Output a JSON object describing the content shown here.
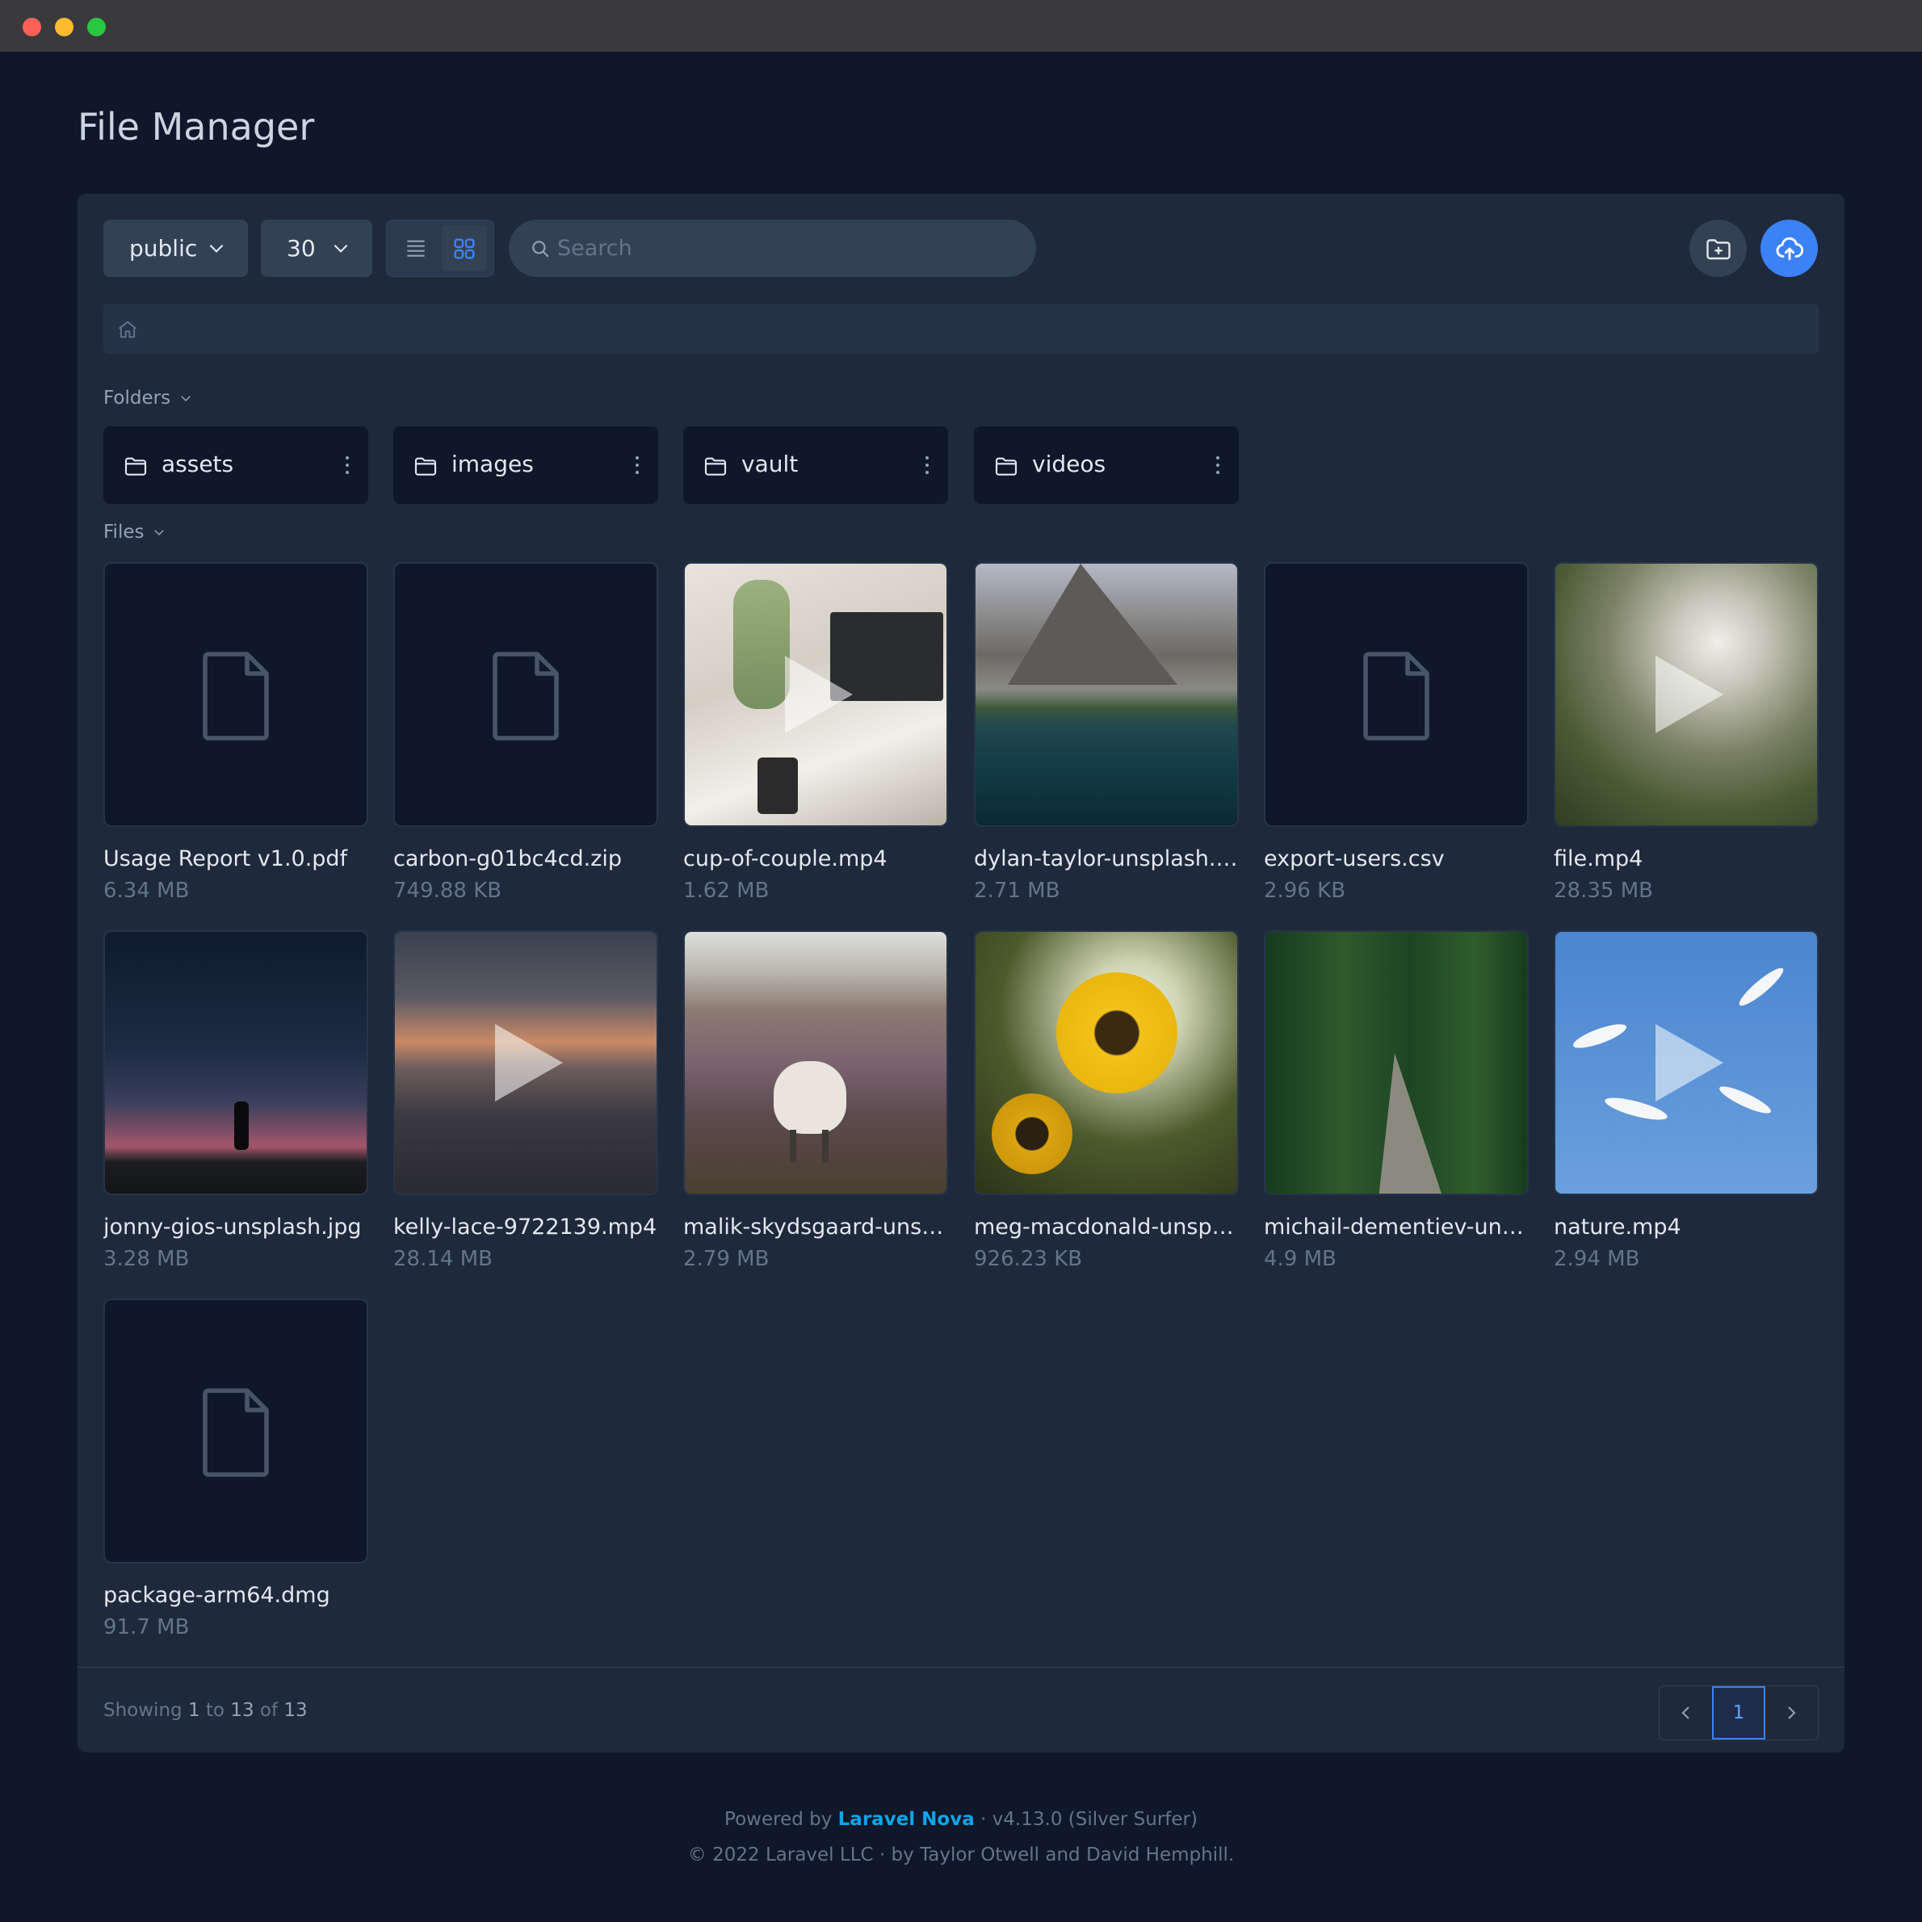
{
  "window": {
    "title": "File Manager"
  },
  "toolbar": {
    "disk_value": "public",
    "per_page_value": "30",
    "search_placeholder": "Search",
    "view_mode": "grid"
  },
  "sections": {
    "folders_label": "Folders",
    "files_label": "Files"
  },
  "folders": [
    {
      "name": "assets"
    },
    {
      "name": "images"
    },
    {
      "name": "vault"
    },
    {
      "name": "videos"
    }
  ],
  "files": [
    {
      "name": "Usage Report v1.0.pdf",
      "size": "6.34 MB",
      "kind": "document",
      "icon": "file-icon"
    },
    {
      "name": "carbon-g01bc4cd.zip",
      "size": "749.88 KB",
      "kind": "document",
      "icon": "file-icon"
    },
    {
      "name": "cup-of-couple.mp4",
      "size": "1.62 MB",
      "kind": "video",
      "icon": "play-icon"
    },
    {
      "name": "dylan-taylor-unsplash.jpg",
      "size": "2.71 MB",
      "kind": "image",
      "icon": "image-thumbnail"
    },
    {
      "name": "export-users.csv",
      "size": "2.96 KB",
      "kind": "document",
      "icon": "file-icon"
    },
    {
      "name": "file.mp4",
      "size": "28.35 MB",
      "kind": "video",
      "icon": "play-icon"
    },
    {
      "name": "jonny-gios-unsplash.jpg",
      "size": "3.28 MB",
      "kind": "image",
      "icon": "image-thumbnail"
    },
    {
      "name": "kelly-lace-9722139.mp4",
      "size": "28.14 MB",
      "kind": "video",
      "icon": "play-icon"
    },
    {
      "name": "malik-skydsgaard-unspl...",
      "size": "2.79 MB",
      "kind": "image",
      "icon": "image-thumbnail"
    },
    {
      "name": "meg-macdonald-unspla...",
      "size": "926.23 KB",
      "kind": "image",
      "icon": "image-thumbnail"
    },
    {
      "name": "michail-dementiev-unsp...",
      "size": "4.9 MB",
      "kind": "image",
      "icon": "image-thumbnail"
    },
    {
      "name": "nature.mp4",
      "size": "2.94 MB",
      "kind": "video",
      "icon": "play-icon"
    },
    {
      "name": "package-arm64.dmg",
      "size": "91.7 MB",
      "kind": "document",
      "icon": "file-icon"
    }
  ],
  "pagination": {
    "showing_prefix": "Showing",
    "from": "1",
    "to_word": "to",
    "to": "13",
    "of_word": "of",
    "total": "13",
    "current_page": "1"
  },
  "footer": {
    "powered_by": "Powered by",
    "brand": "Laravel Nova",
    "version": "· v4.13.0 (Silver Surfer)",
    "copyright": "© 2022 Laravel LLC · by Taylor Otwell and David Hemphill."
  },
  "colors": {
    "background": "#0f172a",
    "panel": "#1e293b",
    "accent": "#3b82f6",
    "brand_link": "#0ea5e9"
  }
}
